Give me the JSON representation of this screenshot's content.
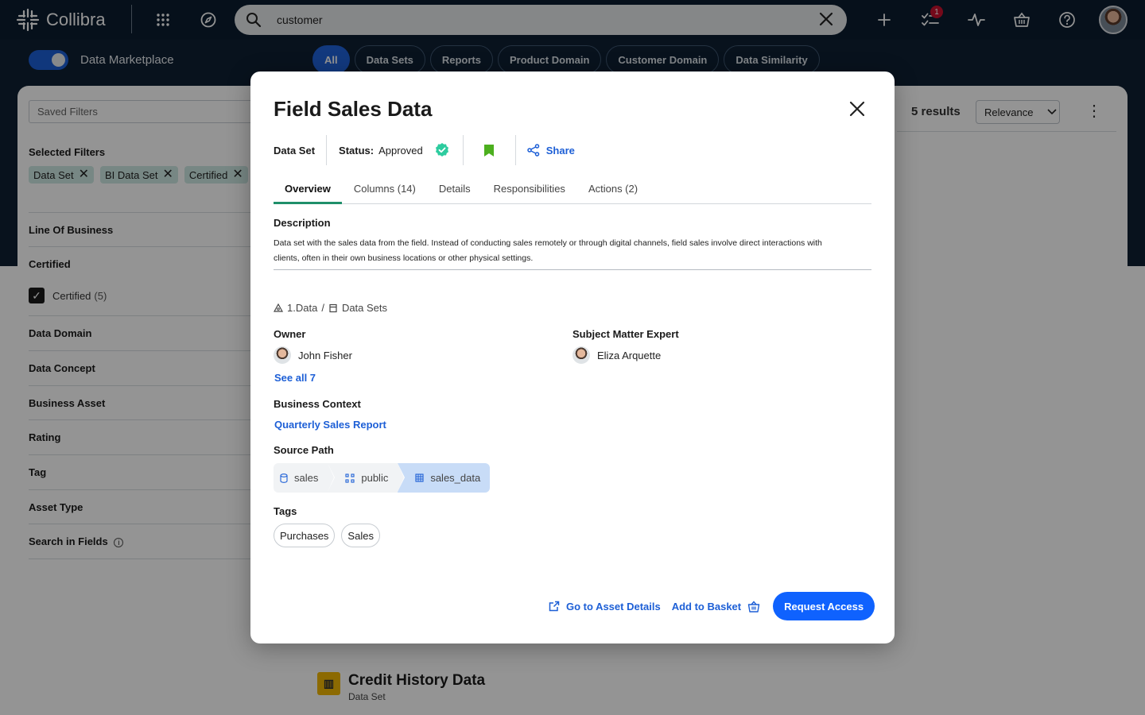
{
  "app": {
    "name": "Collibra"
  },
  "search": {
    "value": "customer"
  },
  "notifications": {
    "count": "1"
  },
  "marketplace": {
    "label": "Data Marketplace"
  },
  "chips": [
    "All",
    "Data Sets",
    "Reports",
    "Product Domain",
    "Customer Domain",
    "Data Similarity"
  ],
  "sidebar": {
    "saved_filters_placeholder": "Saved Filters",
    "selected_filters_title": "Selected Filters",
    "selected_filters": [
      "Data Set",
      "BI Data Set",
      "Certified"
    ],
    "sections": [
      "Line Of Business",
      "Certified",
      "Data Domain",
      "Data Concept",
      "Business Asset",
      "Rating",
      "Tag",
      "Asset Type",
      "Search in Fields"
    ],
    "certified_checkbox": {
      "label": "Certified",
      "count": "(5)",
      "checked": true
    }
  },
  "results": {
    "count_label": "5 results",
    "sort_label": "Relevance"
  },
  "background_card": {
    "title": "Credit History Data",
    "type": "Data Set"
  },
  "modal": {
    "title": "Field Sales Data",
    "asset_type": "Data Set",
    "status_label": "Status:",
    "status_value": "Approved",
    "share_label": "Share",
    "tabs": [
      "Overview",
      "Columns (14)",
      "Details",
      "Responsibilities",
      "Actions (2)"
    ],
    "active_tab": "Overview",
    "description_label": "Description",
    "description_line1": "Data set with the sales data from the field. Instead of conducting sales remotely or through digital channels, field sales involve direct interactions with",
    "description_line2": "clients, often in their own business locations or other physical settings.",
    "breadcrumb": {
      "community": "1.Data",
      "separator": "/",
      "domain": "Data Sets"
    },
    "owner_label": "Owner",
    "owner_name": "John Fisher",
    "see_all": "See all 7",
    "sme_label": "Subject Matter Expert",
    "sme_name": "Eliza Arquette",
    "business_context_label": "Business Context",
    "business_context_link": "Quarterly Sales Report",
    "source_path_label": "Source Path",
    "source_path": [
      "sales",
      "public",
      "sales_data"
    ],
    "tags_label": "Tags",
    "tags": [
      "Purchases",
      "Sales"
    ],
    "footer": {
      "go_to_details": "Go to Asset Details",
      "add_to_basket": "Add to Basket",
      "request_access": "Request Access"
    }
  },
  "colors": {
    "brand_dark": "#0b1c30",
    "primary_blue": "#0f62fe",
    "link_blue": "#1d5fd6",
    "approved_green": "#2dcc9f",
    "tab_underline": "#1f8f6a",
    "filter_tag_bg": "#cde8e3",
    "bookmark_green": "#4caf1e",
    "credit_icon_yellow": "#f2b705"
  }
}
